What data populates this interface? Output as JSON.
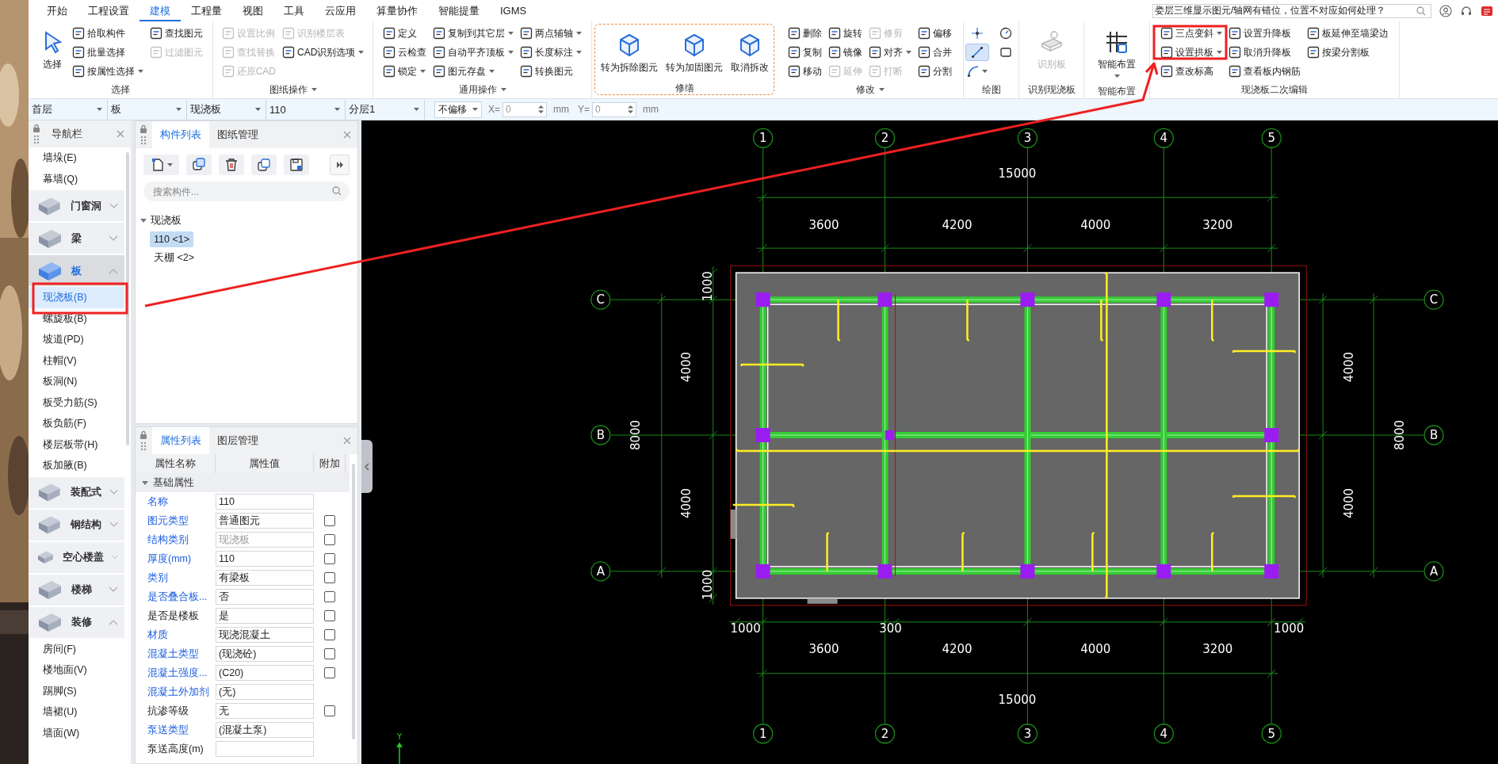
{
  "menu_tabs": [
    {
      "label": "开始",
      "selected": false
    },
    {
      "label": "工程设置",
      "selected": false
    },
    {
      "label": "建模",
      "selected": true
    },
    {
      "label": "工程量",
      "selected": false
    },
    {
      "label": "视图",
      "selected": false
    },
    {
      "label": "工具",
      "selected": false
    },
    {
      "label": "云应用",
      "selected": false
    },
    {
      "label": "算量协作",
      "selected": false
    },
    {
      "label": "智能提量",
      "selected": false
    },
    {
      "label": "IGMS",
      "selected": false
    }
  ],
  "help_search": {
    "value": "娄层三维显示图元/轴网有错位，位置不对应如何处理？"
  },
  "ribbon": [
    {
      "label": "选择",
      "label_menu": false,
      "outlined": false,
      "large": [
        {
          "label": "选择",
          "disabled": false,
          "menu": false
        }
      ],
      "columns": [
        [
          {
            "label": "拾取构件",
            "disabled": false,
            "menu": false
          },
          {
            "label": "批量选择",
            "disabled": false,
            "menu": false
          },
          {
            "label": "按属性选择",
            "disabled": false,
            "menu": true
          }
        ],
        [
          {
            "label": "查找图元",
            "disabled": false,
            "menu": false
          },
          {
            "label": "过滤图元",
            "disabled": true,
            "menu": false
          }
        ]
      ]
    },
    {
      "label": "图纸操作",
      "label_menu": true,
      "outlined": false,
      "columns": [
        [
          {
            "label": "设置比例",
            "disabled": true,
            "menu": false
          },
          {
            "label": "查找替换",
            "disabled": true,
            "menu": false
          },
          {
            "label": "还原CAD",
            "disabled": true,
            "menu": false
          }
        ],
        [
          {
            "label": "识别楼层表",
            "disabled": true,
            "menu": false
          },
          {
            "label": "CAD识别选项",
            "disabled": false,
            "menu": true
          }
        ]
      ]
    },
    {
      "label": "通用操作",
      "label_menu": true,
      "outlined": false,
      "columns": [
        [
          {
            "label": "定义",
            "disabled": false,
            "menu": false
          },
          {
            "label": "云检查",
            "disabled": false,
            "menu": false
          },
          {
            "label": "锁定",
            "disabled": false,
            "menu": true
          }
        ],
        [
          {
            "label": "复制到其它层",
            "disabled": false,
            "menu": true
          },
          {
            "label": "自动平齐顶板",
            "disabled": false,
            "menu": true
          },
          {
            "label": "图元存盘",
            "disabled": false,
            "menu": true
          }
        ],
        [
          {
            "label": "两点辅轴",
            "disabled": false,
            "menu": true
          },
          {
            "label": "长度标注",
            "disabled": false,
            "menu": true
          },
          {
            "label": "转换图元",
            "disabled": false,
            "menu": false
          }
        ]
      ]
    },
    {
      "label": "修缮",
      "label_menu": false,
      "outlined": true,
      "large": [
        {
          "label": "转为拆除图元",
          "disabled": false,
          "menu": false
        },
        {
          "label": "转为加固图元",
          "disabled": false,
          "menu": false
        },
        {
          "label": "取消拆改",
          "disabled": false,
          "menu": false
        }
      ]
    },
    {
      "label": "修改",
      "label_menu": true,
      "outlined": false,
      "columns": [
        [
          {
            "label": "删除",
            "disabled": false,
            "menu": false
          },
          {
            "label": "复制",
            "disabled": false,
            "menu": false
          },
          {
            "label": "移动",
            "disabled": false,
            "menu": false
          }
        ],
        [
          {
            "label": "旋转",
            "disabled": false,
            "menu": false
          },
          {
            "label": "镜像",
            "disabled": false,
            "menu": false
          },
          {
            "label": "延伸",
            "disabled": true,
            "menu": false
          }
        ],
        [
          {
            "label": "修剪",
            "disabled": true,
            "menu": false
          },
          {
            "label": "对齐",
            "disabled": false,
            "menu": true
          },
          {
            "label": "打断",
            "disabled": true,
            "menu": false
          }
        ],
        [
          {
            "label": "偏移",
            "disabled": false,
            "menu": false
          },
          {
            "label": "合并",
            "disabled": false,
            "menu": false
          },
          {
            "label": "分割",
            "disabled": false,
            "menu": false
          }
        ]
      ]
    },
    {
      "label": "绘图",
      "label_menu": false,
      "outlined": false,
      "columns": [
        [
          {
            "selected": false,
            "menu": false
          },
          {
            "selected": true,
            "menu": false
          },
          {
            "selected": false,
            "menu": true
          }
        ],
        [
          {
            "selected": false,
            "menu": false
          },
          {
            "selected": false,
            "menu": false
          }
        ]
      ]
    },
    {
      "label": "识别现浇板",
      "label_menu": false,
      "outlined": false,
      "large": [
        {
          "label": "识别板",
          "disabled": true,
          "menu": false
        }
      ]
    },
    {
      "label": "智能布置",
      "label_menu": false,
      "outlined": false,
      "large": [
        {
          "label": "智能布置",
          "disabled": false,
          "menu": true
        }
      ]
    },
    {
      "label": "现浇板二次编辑",
      "label_menu": false,
      "outlined": false,
      "columns": [
        [
          {
            "label": "三点变斜",
            "disabled": false,
            "menu": true
          },
          {
            "label": "设置拱板",
            "disabled": false,
            "menu": true
          },
          {
            "label": "查改标高",
            "disabled": false,
            "menu": false
          }
        ],
        [
          {
            "label": "设置升降板",
            "disabled": false,
            "menu": false
          },
          {
            "label": "取消升降板",
            "disabled": false,
            "menu": false
          },
          {
            "label": "查看板内钢筋",
            "disabled": false,
            "menu": false
          }
        ],
        [
          {
            "label": "板延伸至墙梁边",
            "disabled": false,
            "menu": false
          },
          {
            "label": "按梁分割板",
            "disabled": false,
            "menu": false
          }
        ]
      ]
    }
  ],
  "toolbar": {
    "selects": [
      "首层",
      "板",
      "现浇板",
      "110",
      "分层1"
    ],
    "offset": "不偏移",
    "x_label": "X=",
    "x_value": "0",
    "x_unit": "mm",
    "y_label": "Y=",
    "y_value": "0",
    "y_unit": "mm"
  },
  "navigator": {
    "title": "导航栏",
    "items": [
      {
        "kind": "item",
        "label": "墙垛(E)",
        "selected": false
      },
      {
        "kind": "item",
        "label": "幕墙(Q)",
        "selected": false
      },
      {
        "kind": "group",
        "label": "门窗洞",
        "expanded": false,
        "selected": false
      },
      {
        "kind": "group",
        "label": "梁",
        "expanded": false,
        "selected": false
      },
      {
        "kind": "group",
        "label": "板",
        "expanded": true,
        "selected": true,
        "children": [
          {
            "label": "现浇板(B)",
            "selected": true
          },
          {
            "label": "螺旋板(B)",
            "selected": false
          },
          {
            "label": "坡道(PD)",
            "selected": false
          },
          {
            "label": "柱帽(V)",
            "selected": false
          },
          {
            "label": "板洞(N)",
            "selected": false
          },
          {
            "label": "板受力筋(S)",
            "selected": false
          },
          {
            "label": "板负筋(F)",
            "selected": false
          },
          {
            "label": "楼层板带(H)",
            "selected": false
          },
          {
            "label": "板加腋(B)",
            "selected": false
          }
        ]
      },
      {
        "kind": "group",
        "label": "装配式",
        "expanded": false,
        "selected": false
      },
      {
        "kind": "group",
        "label": "钢结构",
        "expanded": false,
        "selected": false
      },
      {
        "kind": "group",
        "label": "空心楼盖",
        "expanded": false,
        "selected": false
      },
      {
        "kind": "group",
        "label": "楼梯",
        "expanded": false,
        "selected": false
      },
      {
        "kind": "group",
        "label": "装修",
        "expanded": true,
        "selected": false,
        "children": [
          {
            "label": "房间(F)",
            "selected": false
          },
          {
            "label": "楼地面(V)",
            "selected": false
          },
          {
            "label": "踢脚(S)",
            "selected": false
          },
          {
            "label": "墙裙(U)",
            "selected": false
          },
          {
            "label": "墙面(W)",
            "selected": false
          }
        ]
      }
    ]
  },
  "component_panel": {
    "tabs": [
      {
        "label": "构件列表",
        "selected": true
      },
      {
        "label": "图纸管理",
        "selected": false
      }
    ],
    "search": {
      "placeholder": "搜索构件..."
    },
    "tree": [
      {
        "label": "现浇板",
        "expanded": true,
        "children": [
          {
            "label": "110 <1>",
            "selected": true
          },
          {
            "label": "天棚 <2>",
            "selected": false
          }
        ]
      }
    ]
  },
  "property_panel": {
    "tabs": [
      {
        "label": "属性列表",
        "selected": true
      },
      {
        "label": "图层管理",
        "selected": false
      }
    ],
    "columns": [
      "属性名称",
      "属性值",
      "附加"
    ],
    "groups": [
      {
        "label": "基础属性",
        "expanded": true,
        "rows": [
          {
            "kind": "public",
            "name": "名称",
            "value": "110",
            "disabled": false
          },
          {
            "kind": "public",
            "name": "图元类型",
            "value": "普通图元",
            "disabled": false,
            "checked": false
          },
          {
            "kind": "public",
            "name": "结构类别",
            "value": "现浇板",
            "disabled": true,
            "checked": false
          },
          {
            "kind": "public",
            "name": "厚度(mm)",
            "value": "110",
            "disabled": false,
            "checked": false
          },
          {
            "kind": "public",
            "name": "类别",
            "value": "有梁板",
            "disabled": false,
            "checked": false
          },
          {
            "kind": "public",
            "name": "是否叠合板...",
            "value": "否",
            "disabled": false,
            "checked": false
          },
          {
            "kind": "private",
            "name": "是否是楼板",
            "value": "是",
            "disabled": false,
            "checked": false
          },
          {
            "kind": "public",
            "name": "材质",
            "value": "现浇混凝土",
            "disabled": false,
            "checked": false
          },
          {
            "kind": "public",
            "name": "混凝土类型",
            "value": "(现浇砼)",
            "disabled": false,
            "checked": false
          },
          {
            "kind": "public",
            "name": "混凝土强度...",
            "value": "(C20)",
            "disabled": false,
            "checked": false
          },
          {
            "kind": "public",
            "name": "混凝土外加剂",
            "value": "(无)",
            "disabled": false
          },
          {
            "kind": "private",
            "name": "抗渗等级",
            "value": "无",
            "disabled": false,
            "checked": false
          },
          {
            "kind": "public",
            "name": "泵送类型",
            "value": "(混凝土泵)",
            "disabled": false
          },
          {
            "kind": "private",
            "name": "泵送高度(m)",
            "disabled": false
          }
        ]
      }
    ]
  },
  "canvas": {
    "top_axis_labels": [
      "1",
      "2",
      "3",
      "4",
      "5"
    ],
    "bottom_axis_labels": [
      "1",
      "2",
      "3",
      "4",
      "5"
    ],
    "left_axis_labels": [
      "C",
      "B",
      "A"
    ],
    "right_axis_labels": [
      "C",
      "B",
      "A"
    ],
    "top_total": "15000",
    "top_spans": [
      "3600",
      "4200",
      "4000",
      "3200"
    ],
    "bottom_offsets": [
      "1000",
      "300",
      "1000"
    ],
    "bottom_spans": [
      "3600",
      "4200",
      "4000",
      "3200"
    ],
    "bottom_total": "15000",
    "left_offsets": [
      "1000",
      "1000"
    ],
    "left_spans": [
      "4000",
      "4000"
    ],
    "left_total": "8000",
    "right_spans": [
      "4000",
      "4000"
    ],
    "right_total": "8000",
    "axis_indicator": "Y"
  }
}
